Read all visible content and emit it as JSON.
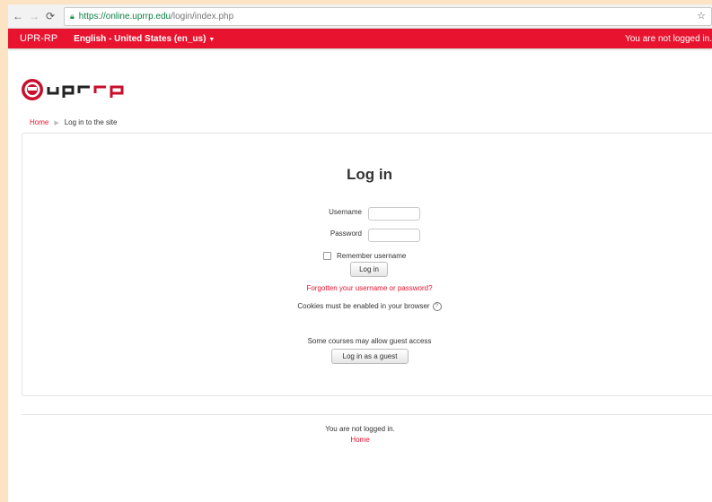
{
  "browser": {
    "url_domain": "https://online.uprrp.edu",
    "url_path": "/login/index.php",
    "back_icon": "arrow-left-icon",
    "forward_icon": "arrow-right-icon",
    "reload_icon": "reload-icon",
    "lock_icon": "lock-icon",
    "star_icon": "star-icon"
  },
  "navbar": {
    "brand": "UPR-RP",
    "language": "English ‎(en_us)‎",
    "language_display": "English - United States (en_us)",
    "login_status": "You are not logged in.",
    "bg_color": "#e8142f"
  },
  "logo": {
    "text": "uprrp"
  },
  "breadcrumb": {
    "home": "Home",
    "current": "Log in to the site"
  },
  "login": {
    "title": "Log in",
    "username_label": "Username",
    "password_label": "Password",
    "remember_label": "Remember username",
    "login_button": "Log in",
    "forgot_link": "Forgotten your username or password?",
    "cookies_text": "Cookies must be enabled in your browser",
    "guest_text": "Some courses may allow guest access",
    "guest_button": "Log in as a guest"
  },
  "footer": {
    "login_status": "You are not logged in.",
    "home_link": "Home"
  }
}
